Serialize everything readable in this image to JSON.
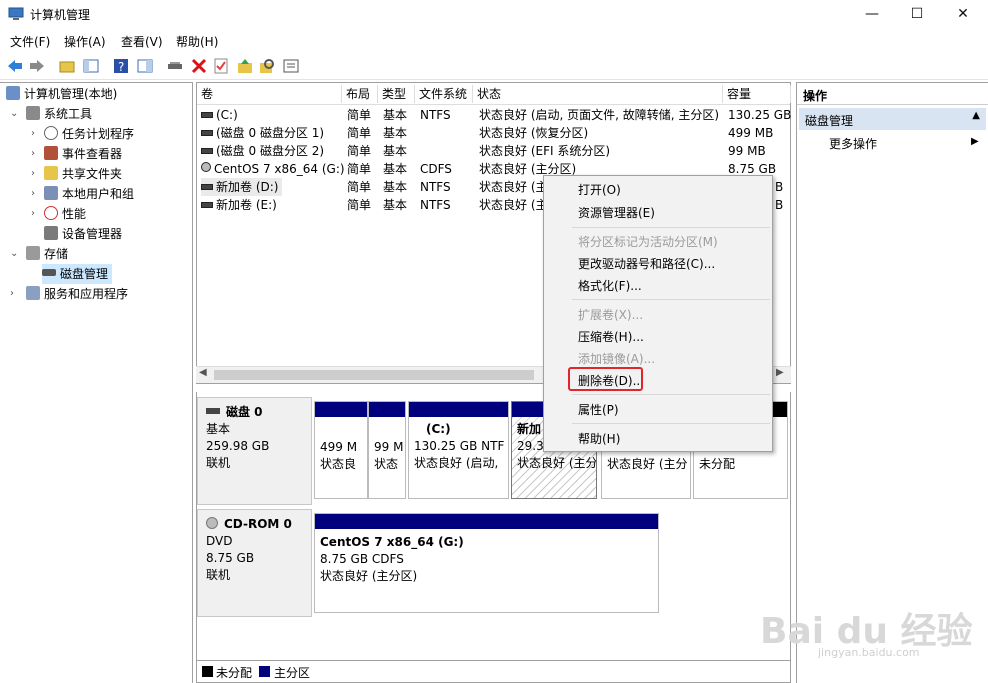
{
  "window": {
    "title": "计算机管理",
    "minimize": "—",
    "maximize": "☐",
    "close": "✕"
  },
  "menu": [
    "文件(F)",
    "操作(A)",
    "查看(V)",
    "帮助(H)"
  ],
  "tree": {
    "root": "计算机管理(本地)",
    "items": [
      "系统工具",
      "任务计划程序",
      "事件查看器",
      "共享文件夹",
      "本地用户和组",
      "性能",
      "设备管理器",
      "存储",
      "磁盘管理",
      "服务和应用程序"
    ]
  },
  "table": {
    "headers": [
      "卷",
      "布局",
      "类型",
      "文件系统",
      "状态",
      "容量"
    ],
    "rows": [
      [
        "(C:)",
        "简单",
        "基本",
        "NTFS",
        "状态良好 (启动, 页面文件, 故障转储, 主分区)",
        "130.25 GB"
      ],
      [
        "(磁盘 0 磁盘分区 1)",
        "简单",
        "基本",
        "",
        "状态良好 (恢复分区)",
        "499 MB"
      ],
      [
        "(磁盘 0 磁盘分区 2)",
        "简单",
        "基本",
        "",
        "状态良好 (EFI 系统分区)",
        "99 MB"
      ],
      [
        "CentOS 7 x86_64 (G:)",
        "简单",
        "基本",
        "CDFS",
        "状态良好 (主分区)",
        "8.75 GB"
      ],
      [
        "新加卷 (D:)",
        "简单",
        "基本",
        "NTFS",
        "状态良好 (主",
        "B"
      ],
      [
        "新加卷 (E:)",
        "简单",
        "基本",
        "NTFS",
        "状态良好 (主",
        "B"
      ]
    ]
  },
  "disks": [
    {
      "name": "磁盘 0",
      "type": "基本",
      "size": "259.98 GB",
      "status": "联机",
      "parts": [
        {
          "l1": "",
          "l2": "499 M",
          "l3": "状态良"
        },
        {
          "l1": "",
          "l2": "99 M",
          "l3": "状态"
        },
        {
          "l1": "(C:)",
          "l2": "130.25 GB NTF",
          "l3": "状态良好 (启动,"
        },
        {
          "l1": "新加",
          "l2": "29.30",
          "l3": "状态良好 (主分"
        },
        {
          "l1": "",
          "l2": "",
          "l3": "状态良好 (主分"
        },
        {
          "l1": "",
          "l2": "",
          "l3": "未分配"
        }
      ]
    },
    {
      "name": "CD-ROM 0",
      "type": "DVD",
      "size": "8.75 GB",
      "status": "联机",
      "parts": [
        {
          "l1": "CentOS 7 x86_64  (G:)",
          "l2": "8.75 GB CDFS",
          "l3": "状态良好 (主分区)"
        }
      ]
    }
  ],
  "legend": {
    "unallocated": "未分配",
    "primary": "主分区"
  },
  "actions": {
    "header": "操作",
    "section": "磁盘管理",
    "more": "更多操作"
  },
  "context_menu": [
    "打开(O)",
    "资源管理器(E)",
    "将分区标记为活动分区(M)",
    "更改驱动器号和路径(C)...",
    "格式化(F)...",
    "扩展卷(X)...",
    "压缩卷(H)...",
    "添加镜像(A)...",
    "删除卷(D)...",
    "属性(P)",
    "帮助(H)"
  ],
  "watermark": {
    "brand": "Bai du 经验",
    "url": "jingyan.baidu.com"
  },
  "colors": {
    "primary_partition": "#00007f",
    "unallocated": "#000000",
    "highlight_box": "#e0262a",
    "selected_bg": "#cce8ff"
  }
}
